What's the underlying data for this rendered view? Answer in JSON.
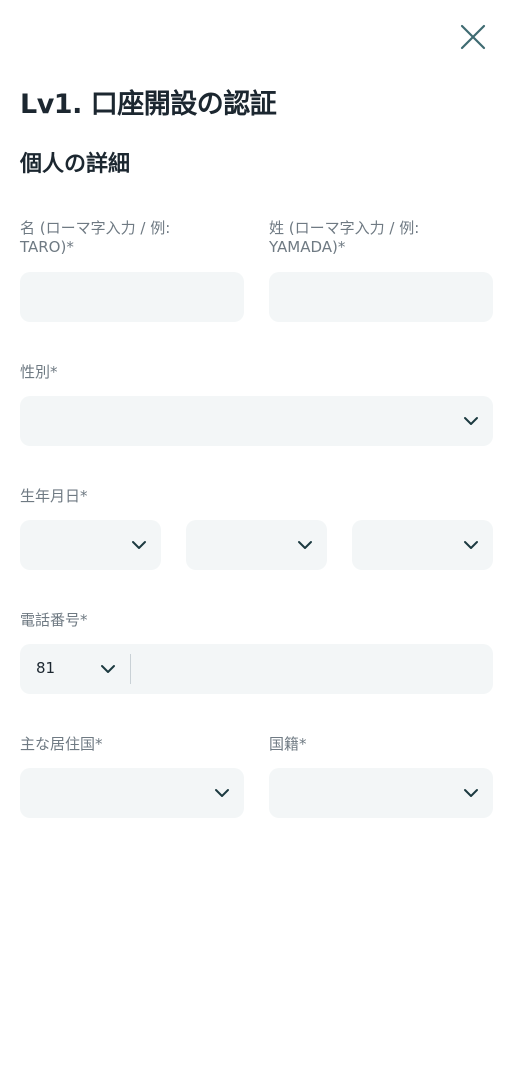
{
  "header": {
    "title": "Lv1. 口座開設の認証",
    "close_icon": "close-icon"
  },
  "section": {
    "title": "個人の詳細"
  },
  "fields": {
    "first_name_label_line1": "名 (ローマ字入力 / 例:",
    "first_name_label_line2": "TARO)*",
    "last_name_label_line1": "姓 (ローマ字入力 / 例:",
    "last_name_label_line2": "YAMADA)*",
    "gender_label": "性別*",
    "birthdate_label": "生年月日*",
    "phone_label": "電話番号*",
    "phone_country_code": "81",
    "residence_label": "主な居住国*",
    "nationality_label": "国籍*"
  },
  "colors": {
    "text_primary": "#1c2730",
    "label": "#6f7a83",
    "field_bg": "#f3f6f7",
    "accent": "#3f6b72"
  }
}
